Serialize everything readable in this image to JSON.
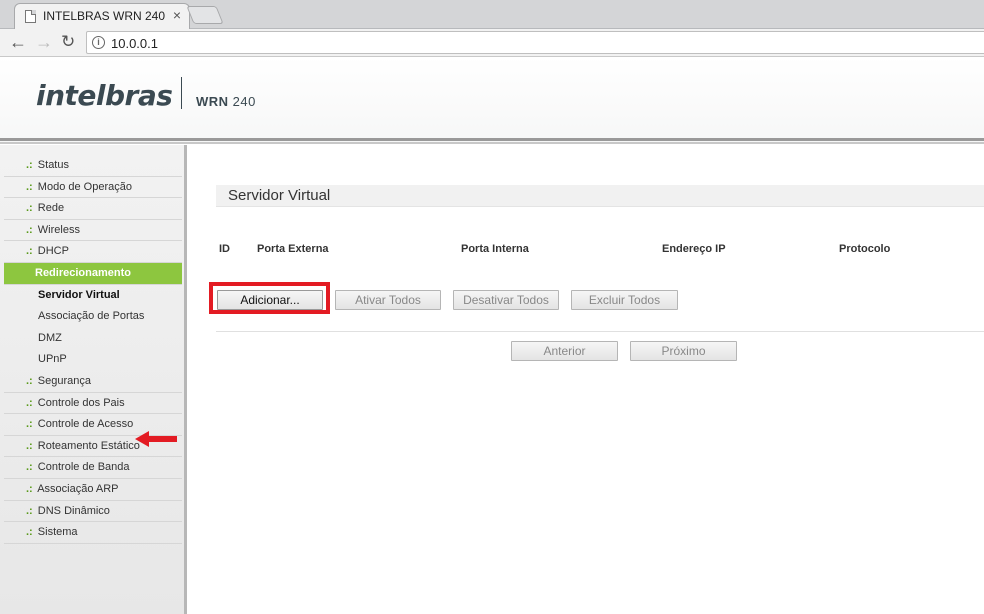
{
  "browser": {
    "tab_title": "INTELBRAS WRN 240",
    "tab_close": "×",
    "url": "10.0.0.1",
    "icons": {
      "back": "arrow-left-icon",
      "forward": "arrow-right-icon",
      "reload": "reload-icon",
      "info": "info-icon"
    }
  },
  "header": {
    "brand": "intelbras",
    "model_prefix": "WRN",
    "model_number": "240",
    "accent_color": "#8dc63f"
  },
  "sidebar": {
    "prefix": ".:",
    "items_top": [
      {
        "label": "Status"
      },
      {
        "label": "Modo de Operação"
      },
      {
        "label": "Rede"
      },
      {
        "label": "Wireless"
      },
      {
        "label": "DHCP"
      }
    ],
    "active_section": "Redirecionamento",
    "sub_items": [
      {
        "label": "Servidor Virtual",
        "current": true
      },
      {
        "label": "Associação de Portas"
      },
      {
        "label": "DMZ"
      },
      {
        "label": "UPnP"
      }
    ],
    "items_bottom": [
      {
        "label": "Segurança"
      },
      {
        "label": "Controle dos Pais"
      },
      {
        "label": "Controle de Acesso"
      },
      {
        "label": "Roteamento Estático"
      },
      {
        "label": "Controle de Banda"
      },
      {
        "label": "Associação ARP"
      },
      {
        "label": "DNS Dinâmico"
      },
      {
        "label": "Sistema"
      }
    ]
  },
  "main": {
    "title": "Servidor Virtual",
    "columns": [
      "ID",
      "Porta Externa",
      "Porta Interna",
      "Endereço IP",
      "Protocolo"
    ],
    "buttons": {
      "add": "Adicionar...",
      "enable_all": "Ativar Todos",
      "disable_all": "Desativar Todos",
      "delete_all": "Excluir Todos",
      "previous": "Anterior",
      "next": "Próximo"
    },
    "highlight_color": "#e31b23"
  }
}
